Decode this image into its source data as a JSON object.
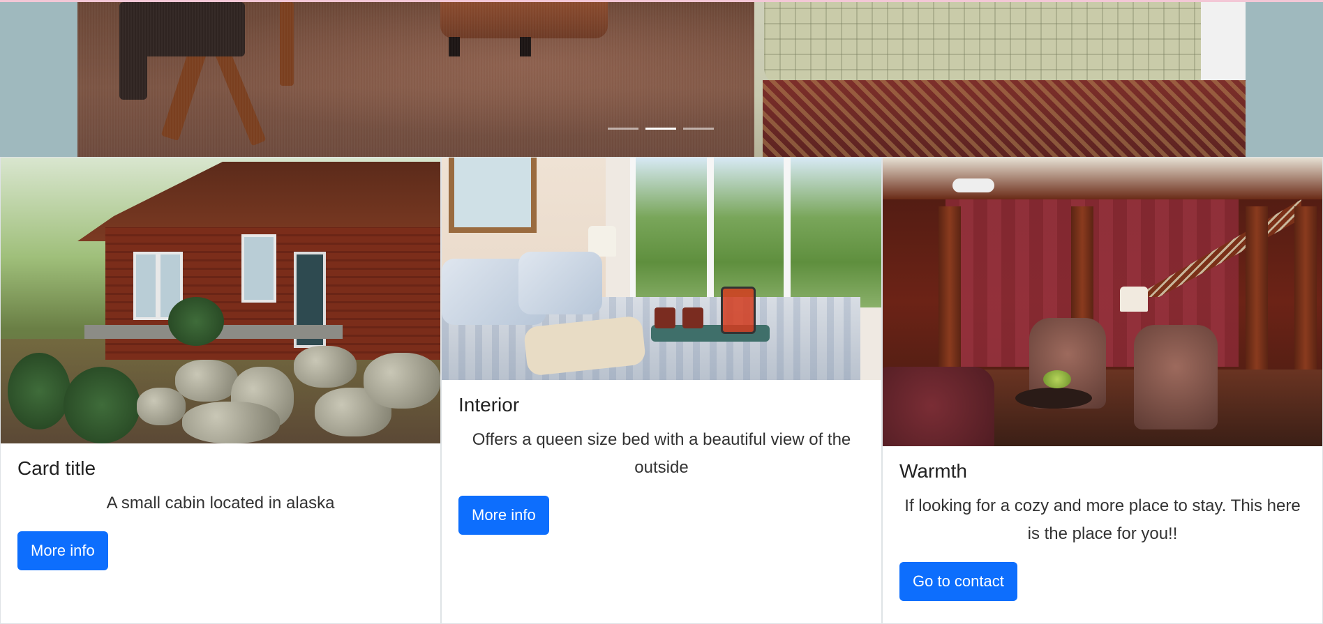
{
  "carousel": {
    "indicators": [
      {
        "label": "Slide 1",
        "active": false
      },
      {
        "label": "Slide 2",
        "active": true
      },
      {
        "label": "Slide 3",
        "active": false
      }
    ]
  },
  "cards": [
    {
      "image": "cabin exterior photo",
      "title": "Card title",
      "text": "A small cabin located in alaska",
      "button": "More info"
    },
    {
      "image": "bedroom interior photo",
      "title": "Interior",
      "text": "Offers a queen size bed with a beautiful view of the outside",
      "button": "More info"
    },
    {
      "image": "parlor living room photo",
      "title": "Warmth",
      "text": "If looking for a cozy and more place to stay. This here is the place for you!!",
      "button": "Go to contact"
    }
  ],
  "colors": {
    "page_background": "#9fb9be",
    "button": "#0d6efd",
    "button_text": "#ffffff"
  }
}
